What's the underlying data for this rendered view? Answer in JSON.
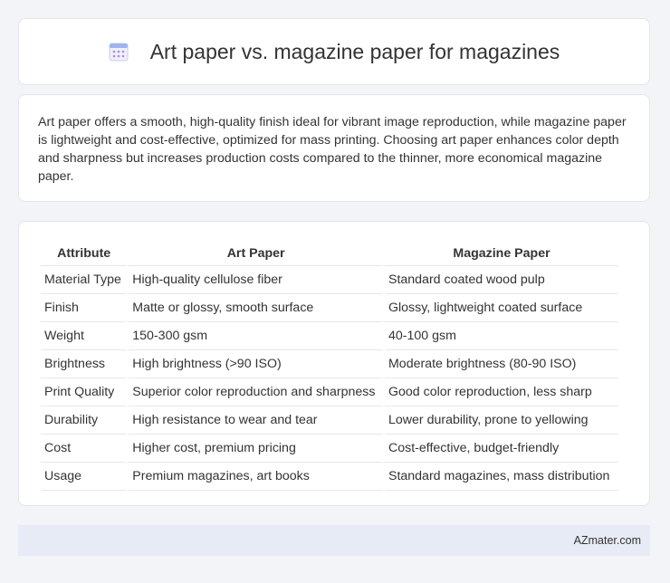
{
  "header": {
    "title": "Art paper vs. magazine paper for magazines",
    "icon": "calendar-icon"
  },
  "summary": {
    "text": "Art paper offers a smooth, high-quality finish ideal for vibrant image reproduction, while magazine paper is lightweight and cost-effective, optimized for mass printing. Choosing art paper enhances color depth and sharpness but increases production costs compared to the thinner, more economical magazine paper."
  },
  "table": {
    "headers": [
      "Attribute",
      "Art Paper",
      "Magazine Paper"
    ],
    "rows": [
      [
        "Material Type",
        "High-quality cellulose fiber",
        "Standard coated wood pulp"
      ],
      [
        "Finish",
        "Matte or glossy, smooth surface",
        "Glossy, lightweight coated surface"
      ],
      [
        "Weight",
        "150-300 gsm",
        "40-100 gsm"
      ],
      [
        "Brightness",
        "High brightness (>90 ISO)",
        "Moderate brightness (80-90 ISO)"
      ],
      [
        "Print Quality",
        "Superior color reproduction and sharpness",
        "Good color reproduction, less sharp"
      ],
      [
        "Durability",
        "High resistance to wear and tear",
        "Lower durability, prone to yellowing"
      ],
      [
        "Cost",
        "Higher cost, premium pricing",
        "Cost-effective, budget-friendly"
      ],
      [
        "Usage",
        "Premium magazines, art books",
        "Standard magazines, mass distribution"
      ]
    ]
  },
  "footer": {
    "site": "AZmater.com"
  },
  "colors": {
    "background": "#f3f4f8",
    "footer_bg": "#e6ebf6",
    "icon_accent": "#8a7fd6"
  }
}
